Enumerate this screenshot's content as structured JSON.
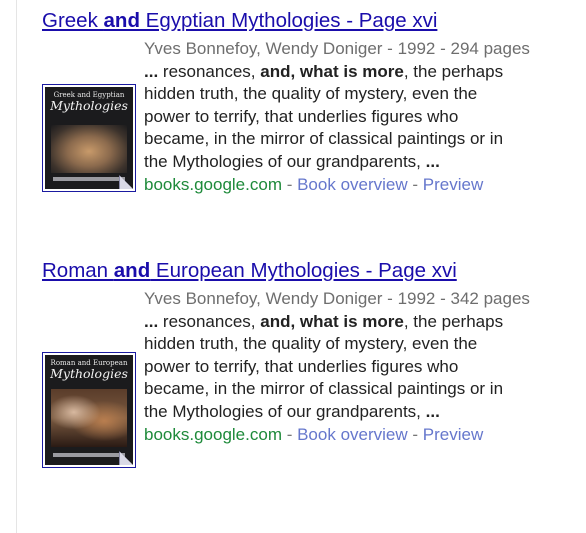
{
  "results": [
    {
      "title_pre": "Greek ",
      "title_bold": "and",
      "title_post": " Egyptian Mythologies - Page xvi",
      "meta": "Yves Bonnefoy, Wendy Doniger - 1992 - 294 pages",
      "snippet": [
        {
          "text": "... ",
          "bold": true
        },
        {
          "text": "resonances, ",
          "bold": false
        },
        {
          "text": "and, what is more",
          "bold": true
        },
        {
          "text": ", the perhaps hidden truth, the quality of mystery, even the power to terrify, that underlies figures who became, in the mirror of classical paintings or in the Mythologies of our grandparents, ",
          "bold": false
        },
        {
          "text": "...",
          "bold": true
        }
      ],
      "domain": "books.google.com",
      "link_overview": "Book overview",
      "link_preview": "Preview",
      "separator": " - ",
      "cover_small": "Greek and Egyptian",
      "cover_big": "Mythologies"
    },
    {
      "title_pre": "Roman ",
      "title_bold": "and",
      "title_post": " European Mythologies - Page xvi",
      "meta": "Yves Bonnefoy, Wendy Doniger - 1992 - 342 pages",
      "snippet": [
        {
          "text": "... ",
          "bold": true
        },
        {
          "text": "resonances, ",
          "bold": false
        },
        {
          "text": "and, what is more",
          "bold": true
        },
        {
          "text": ", the perhaps hidden truth, the quality of mystery, even the power to terrify, that underlies figures who became, in the mirror of classical paintings or in the Mythologies of our grandparents, ",
          "bold": false
        },
        {
          "text": "...",
          "bold": true
        }
      ],
      "domain": "books.google.com",
      "link_overview": "Book overview",
      "link_preview": "Preview",
      "separator": " - ",
      "cover_small": "Roman and European",
      "cover_big": "Mythologies"
    }
  ],
  "colors": {
    "title_link": "#1a0dab",
    "meta": "#6e6e6e",
    "domain": "#1e8a3a",
    "secondary_link": "#6677cc"
  }
}
